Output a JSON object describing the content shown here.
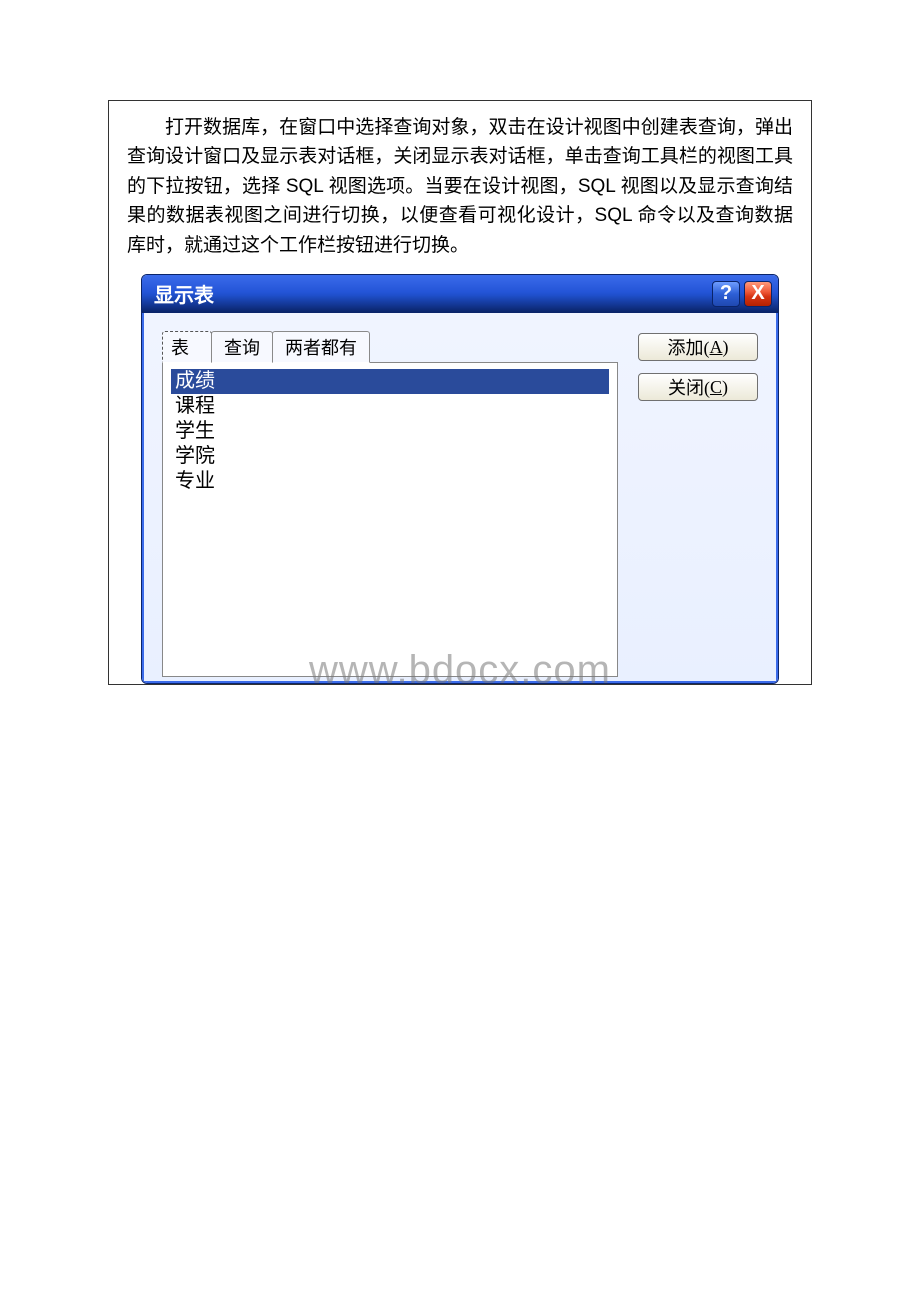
{
  "paragraph": "打开数据库，在窗口中选择查询对象，双击在设计视图中创建表查询，弹出查询设计窗口及显示表对话框，关闭显示表对话框，单击查询工具栏的视图工具的下拉按钮，选择 SQL 视图选项。当要在设计视图，SQL 视图以及显示查询结果的数据表视图之间进行切换，以便查看可视化设计，SQL 命令以及查询数据库时，就通过这个工作栏按钮进行切换。",
  "dialog": {
    "title": "显示表",
    "help_glyph": "?",
    "close_glyph": "X",
    "tabs": {
      "t0": "表",
      "t1": "查询",
      "t2": "两者都有"
    },
    "items": {
      "i0": "成绩",
      "i1": "课程",
      "i2": "学生",
      "i3": "学院",
      "i4": "专业"
    },
    "buttons": {
      "add_prefix": "添加(",
      "add_key": "A",
      "add_suffix": ")",
      "close_prefix": "关闭(",
      "close_key": "C",
      "close_suffix": ")"
    }
  },
  "watermark": "www.bdocx.com"
}
